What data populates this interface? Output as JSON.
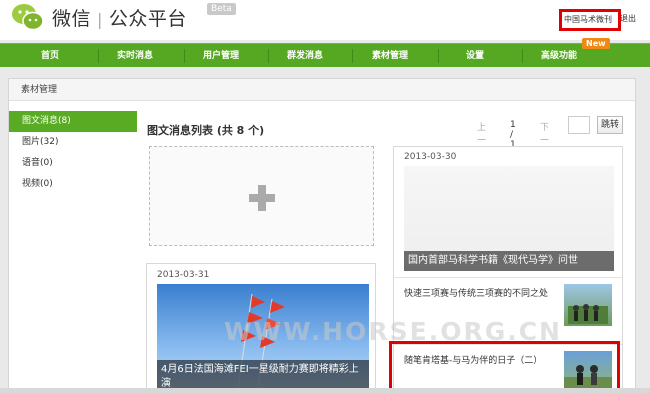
{
  "header": {
    "app_name": "微信",
    "app_sub": "公众平台",
    "beta": "Beta",
    "account_name": "中国马术微刊",
    "logout": "退出"
  },
  "nav": {
    "items": [
      "首页",
      "实时消息",
      "用户管理",
      "群发消息",
      "素材管理",
      "设置",
      "高级功能"
    ],
    "new_badge": "New"
  },
  "panel": {
    "title": "素材管理"
  },
  "sidebar": {
    "items": [
      "图文消息(8)",
      "图片(32)",
      "语音(0)",
      "视频(0)"
    ]
  },
  "list": {
    "title": "图文消息列表 (共 8 个)",
    "pager": {
      "prev": "上一页",
      "current": "1 / 1",
      "next": "下一页",
      "jump": "跳转"
    }
  },
  "cards": [
    {
      "date": "2013-03-31",
      "cover_title": "4月6日法国海滩FEI一星级耐力赛即将精彩上演"
    },
    {
      "date": "2013-03-30",
      "cover_title": "国内首部马科学书籍《现代马学》问世",
      "sub_items": [
        "快速三项赛与传统三项赛的不同之处",
        "随笔肯塔基-与马为伴的日子（二）"
      ]
    }
  ],
  "watermark": "WWW.HORSE.ORG.CN",
  "colors": {
    "nav_green": "#56a822",
    "highlight_red": "#e10000",
    "new_orange": "#f08a14"
  }
}
